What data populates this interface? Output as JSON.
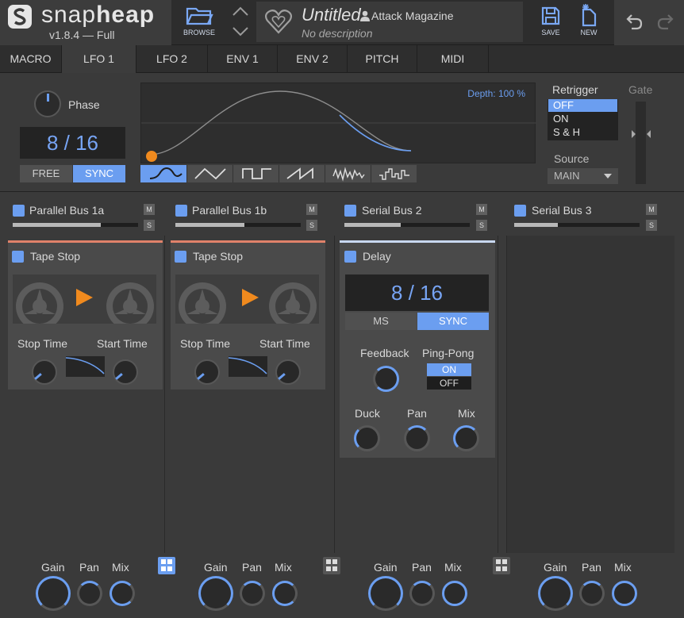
{
  "app": {
    "name_light": "snap",
    "name_bold": "heap",
    "version": "v1.8.4 — Full"
  },
  "toolbar": {
    "browse": "BROWSE",
    "save": "SAVE",
    "new": "NEW"
  },
  "preset": {
    "title": "Untitled",
    "author": "Attack Magazine",
    "description": "No description"
  },
  "tabs": [
    "MACRO",
    "LFO 1",
    "LFO 2",
    "ENV 1",
    "ENV 2",
    "PITCH",
    "MIDI"
  ],
  "selected_tab": "LFO 1",
  "lfo": {
    "phase_label": "Phase",
    "rate": "8 / 16",
    "free": "FREE",
    "sync": "SYNC",
    "sync_mode": "SYNC",
    "depth": "Depth: 100 %",
    "retrigger_label": "Retrigger",
    "retrigger_options": [
      "OFF",
      "ON",
      "S & H"
    ],
    "retrigger_selected": "OFF",
    "gate_label": "Gate",
    "source_label": "Source",
    "source_value": "MAIN",
    "shapes": [
      "sine",
      "triangle",
      "square",
      "saw",
      "noise",
      "steps"
    ],
    "selected_shape": "sine"
  },
  "buses": [
    {
      "name": "Parallel Bus 1a",
      "m": "M",
      "s": "S",
      "level": 0.7
    },
    {
      "name": "Parallel Bus 1b",
      "m": "M",
      "s": "S",
      "level": 0.55
    },
    {
      "name": "Serial Bus 2",
      "m": "M",
      "s": "S",
      "level": 0.45
    },
    {
      "name": "Serial Bus 3",
      "m": "M",
      "s": "S",
      "level": 0.35
    }
  ],
  "modules": {
    "tape1": {
      "name": "Tape Stop",
      "stop": "Stop Time",
      "start": "Start Time"
    },
    "tape2": {
      "name": "Tape Stop",
      "stop": "Stop Time",
      "start": "Start Time"
    },
    "delay": {
      "name": "Delay",
      "rate": "8 / 16",
      "ms": "MS",
      "sync": "SYNC",
      "feedback": "Feedback",
      "pingpong": "Ping-Pong",
      "on": "ON",
      "off": "OFF",
      "pingpong_selected": "ON",
      "duck": "Duck",
      "pan": "Pan",
      "mix": "Mix"
    }
  },
  "bottom": {
    "gain": "Gain",
    "pan": "Pan",
    "mix": "Mix"
  },
  "colors": {
    "accent": "#6b9ef0",
    "tape_bar": "#e0826a",
    "delay_bar": "#c8d8f0",
    "orange": "#f08a1e"
  }
}
